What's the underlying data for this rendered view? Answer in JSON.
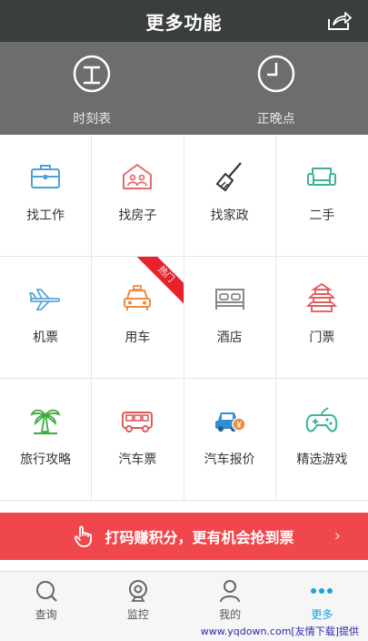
{
  "header": {
    "title": "更多功能"
  },
  "quick": [
    {
      "label": "时刻表",
      "icon": "timetable-icon"
    },
    {
      "label": "正晚点",
      "icon": "clock-icon"
    }
  ],
  "grid": [
    {
      "label": "找工作",
      "icon": "briefcase-icon",
      "color": "#4aa3d8"
    },
    {
      "label": "找房子",
      "icon": "house-icon",
      "color": "#e56b6b"
    },
    {
      "label": "找家政",
      "icon": "broom-icon",
      "color": "#333333"
    },
    {
      "label": "二手",
      "icon": "sofa-icon",
      "color": "#3bb39a"
    },
    {
      "label": "机票",
      "icon": "airplane-icon",
      "color": "#5aa7d6"
    },
    {
      "label": "用车",
      "icon": "taxi-icon",
      "color": "#f08a3c",
      "badge": "热门"
    },
    {
      "label": "酒店",
      "icon": "bed-icon",
      "color": "#888888"
    },
    {
      "label": "门票",
      "icon": "pagoda-icon",
      "color": "#e05a5a"
    },
    {
      "label": "旅行攻略",
      "icon": "palm-tree-icon",
      "color": "#3daa3d"
    },
    {
      "label": "汽车票",
      "icon": "bus-icon",
      "color": "#e05a5a"
    },
    {
      "label": "汽车报价",
      "icon": "car-price-icon",
      "color": "#2f8fd0"
    },
    {
      "label": "精选游戏",
      "icon": "gamepad-icon",
      "color": "#3bb39a"
    }
  ],
  "banner": {
    "text": "打码赚积分，更有机会抢到票",
    "chevron": "›"
  },
  "tabs": [
    {
      "label": "查询",
      "icon": "search-icon",
      "active": false
    },
    {
      "label": "监控",
      "icon": "webcam-icon",
      "active": false
    },
    {
      "label": "我的",
      "icon": "user-icon",
      "active": false
    },
    {
      "label": "更多",
      "icon": "more-icon",
      "active": true
    }
  ],
  "watermark": "www.yqdown.com[友情下载]提供",
  "colors": {
    "header": "#3b3e3f",
    "quick_bg": "#6c6d6e",
    "banner": "#f0474c",
    "active_tab": "#1aa3d9"
  }
}
